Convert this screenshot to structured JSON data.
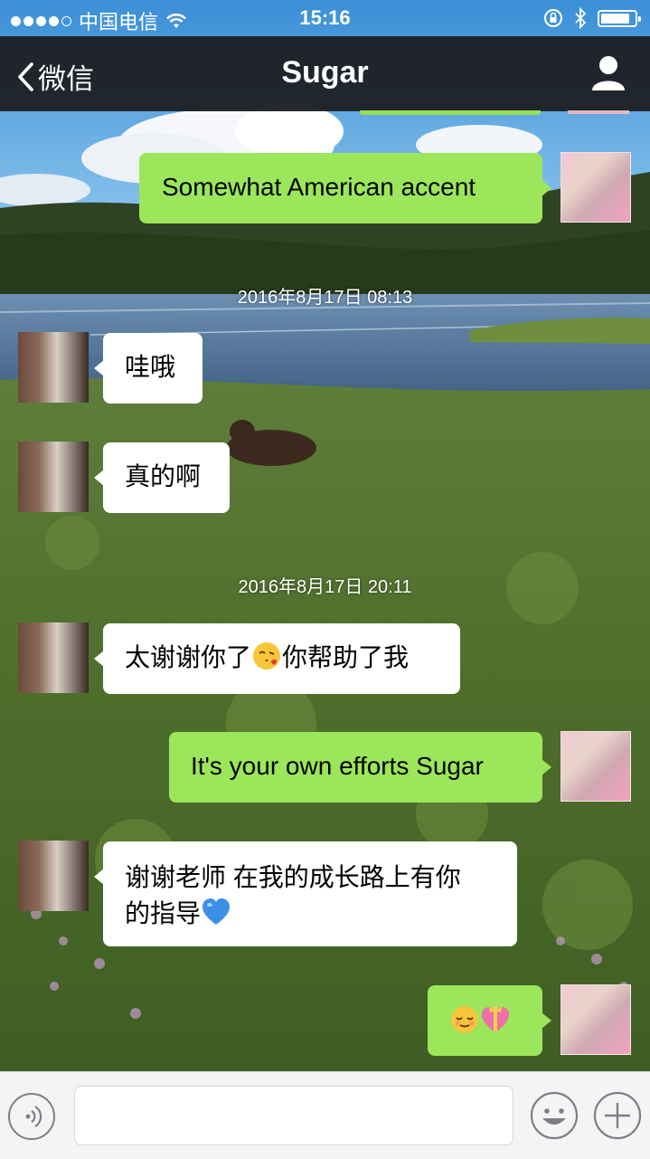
{
  "status_bar": {
    "carrier": "中国电信",
    "time": "15:16",
    "battery_level": 0.85
  },
  "nav": {
    "back_label": "微信",
    "title": "Sugar"
  },
  "messages": [
    {
      "type": "out",
      "text": "Somewhat American accent"
    },
    {
      "type": "timestamp",
      "text": "2016年8月17日 08:13"
    },
    {
      "type": "in",
      "text": "哇哦"
    },
    {
      "type": "in",
      "text": "真的啊"
    },
    {
      "type": "timestamp",
      "text": "2016年8月17日 20:11"
    },
    {
      "type": "in",
      "text_before": "太谢谢你了",
      "emoji": "kissing-face-emoji",
      "text_after": "你帮助了我"
    },
    {
      "type": "out",
      "text": "It's your own efforts Sugar"
    },
    {
      "type": "in",
      "line1": "谢谢老师 在我的成长路上有你",
      "line2": "的指导",
      "emoji": "blue-heart-emoji"
    },
    {
      "type": "out",
      "emojis": [
        "relieved-face-emoji",
        "heart-with-ribbon-emoji"
      ]
    }
  ],
  "icons": {
    "back": "chevron-left-icon",
    "profile": "person-icon",
    "voice": "voice-input-icon",
    "emoji": "smiley-face-icon",
    "more": "plus-icon"
  },
  "colors": {
    "outgoing_bubble": "#9be65a",
    "incoming_bubble": "#ffffff",
    "nav_bar": "#1e2025",
    "input_bar": "#f4f4f6"
  }
}
